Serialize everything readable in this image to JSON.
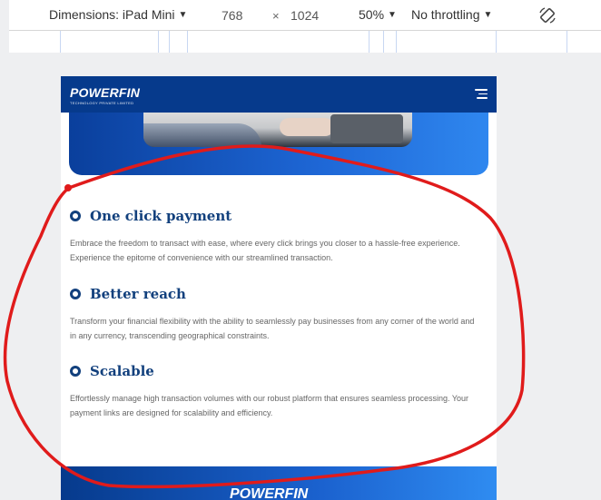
{
  "toolbar": {
    "dimensions_label": "Dimensions: iPad Mini",
    "width": "768",
    "times": "×",
    "height": "1024",
    "zoom": "50%",
    "throttling": "No throttling"
  },
  "site": {
    "logo": "POWERFIN",
    "logo_subtitle": "TECHNOLOGY PRIVATE LIMITED",
    "features": [
      {
        "title": "One click payment",
        "description": "Embrace the freedom to transact with ease, where every click brings you closer to a hassle-free experience. Experience the epitome of convenience with our streamlined transaction."
      },
      {
        "title": "Better reach",
        "description": "Transform your financial flexibility with the ability to seamlessly pay businesses from any corner of the world and in any currency, transcending geographical constraints."
      },
      {
        "title": "Scalable",
        "description": "Effortlessly manage high transaction volumes with our robust platform that ensures seamless processing. Your payment links are designed for scalability and efficiency."
      }
    ],
    "footer_logo": "POWERFIN"
  },
  "colors": {
    "brand_navy": "#063a8c",
    "brand_blue": "#2f87ef",
    "heading": "#12407d",
    "annotation_red": "#e01b1b"
  }
}
